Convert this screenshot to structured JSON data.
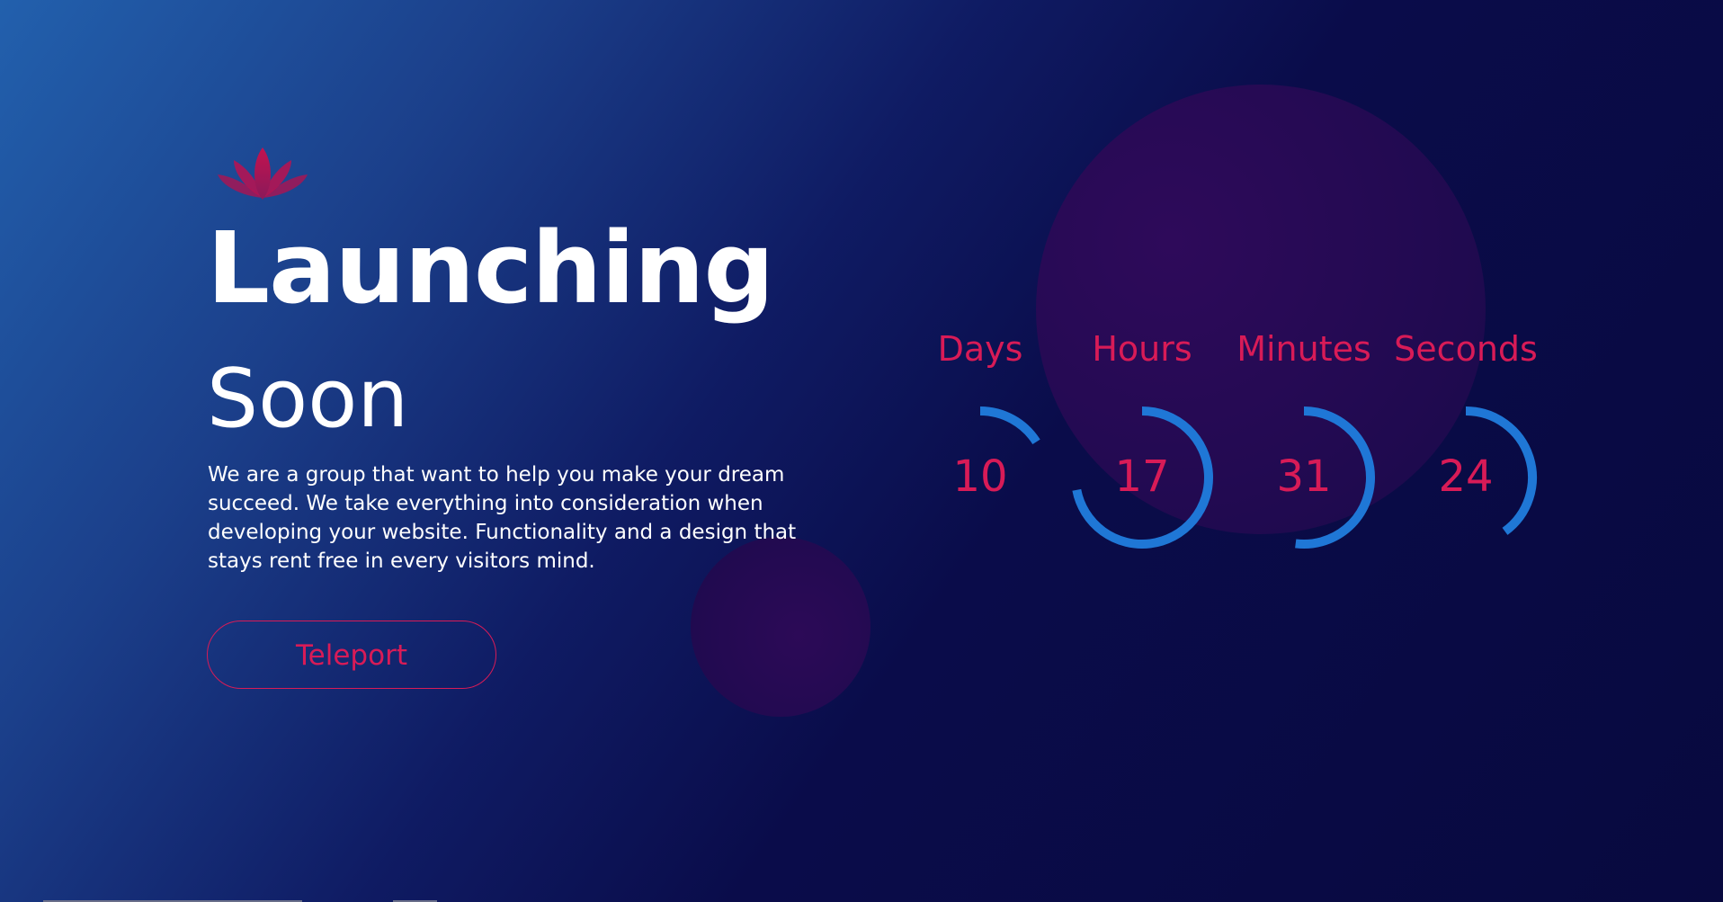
{
  "hero": {
    "title_line1": "Launching",
    "title_line2": "Soon",
    "description": "We are a group that want to help you make your dream succeed. We take everything into consideration when developing your website. Functionality and a design that stays rent free in every visitors mind.",
    "button_label": "Teleport"
  },
  "countdown": {
    "units": [
      {
        "label": "Days",
        "value": "10",
        "fraction": 0.16
      },
      {
        "label": "Hours",
        "value": "17",
        "fraction": 0.72
      },
      {
        "label": "Minutes",
        "value": "31",
        "fraction": 0.52
      },
      {
        "label": "Seconds",
        "value": "24",
        "fraction": 0.4
      }
    ]
  },
  "icons": {
    "logo": "lotus-icon"
  },
  "colors": {
    "accent": "#d81b57",
    "ring": "#1f77d6",
    "background_dark": "#08093f",
    "background_light": "#2260ad",
    "blob": "#2a0a56"
  }
}
